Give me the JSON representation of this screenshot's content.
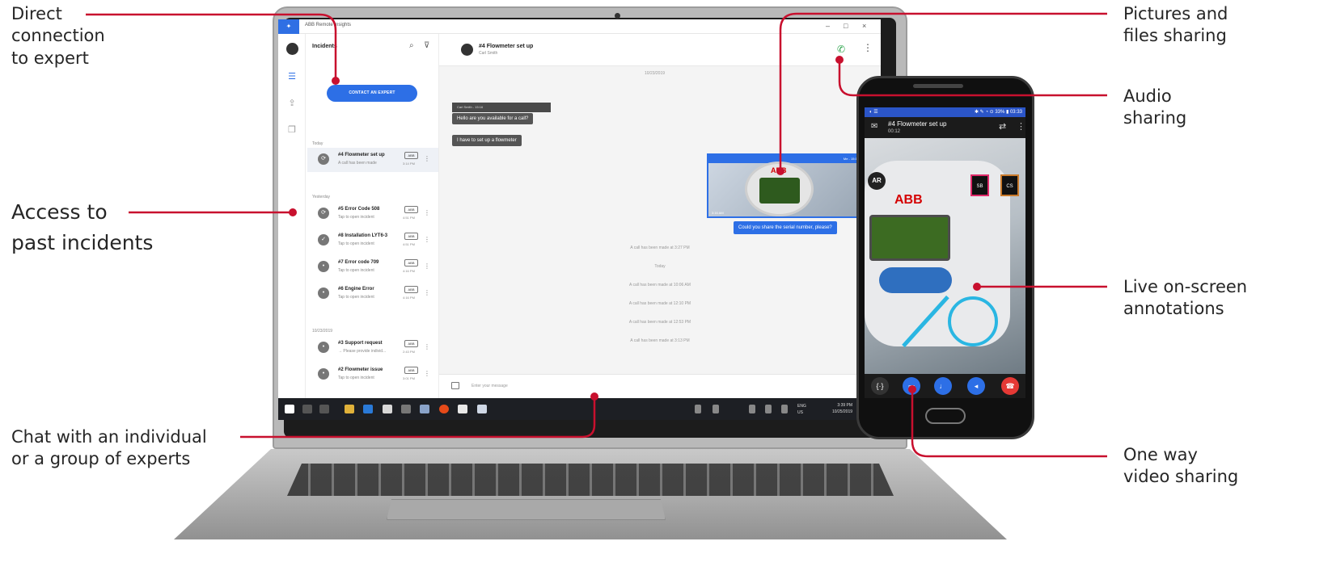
{
  "callouts": {
    "direct_connection": [
      "Direct",
      "connection",
      "to expert"
    ],
    "past_incidents": [
      "Access to",
      "past incidents"
    ],
    "chat_experts": [
      "Chat with an individual",
      "or a group of experts"
    ],
    "pictures_files": [
      "Pictures and",
      "files sharing"
    ],
    "audio": [
      "Audio",
      "sharing"
    ],
    "annotations": [
      "Live on-screen",
      "annotations"
    ],
    "video": [
      "One way",
      "video sharing"
    ]
  },
  "colors": {
    "callout_line": "#c8102e",
    "accent_blue": "#2d6fe6",
    "call_green": "#2aa34a",
    "end_call_red": "#e53935"
  },
  "laptop_app": {
    "window_title": "ABB Remote Insights",
    "window_controls": [
      "–",
      "□",
      "×"
    ],
    "rail_icons": [
      "avatar-icon",
      "incidents-icon",
      "upload-icon",
      "copy-icon"
    ],
    "incidents": {
      "header": "Incidents",
      "search_icon": "search-icon",
      "filter_icon": "filter-icon",
      "contact_button": "CONTACT AN EXPERT",
      "groups": [
        {
          "label": "Today",
          "items": [
            {
              "title": "#4 Flowmeter set up",
              "subtitle": "A call has been made",
              "badge": "ABB",
              "time": "3:14 PM",
              "selected": true
            }
          ]
        },
        {
          "label": "Yesterday",
          "items": [
            {
              "title": "#5 Error Code 508",
              "subtitle": "Tap to open incident",
              "badge": "ABB",
              "time": "4:51 PM",
              "selected": false
            },
            {
              "title": "#8 Installation LYT6-3",
              "subtitle": "Tap to open incident",
              "badge": "ABB",
              "time": "4:51 PM",
              "selected": false
            },
            {
              "title": "#7 Error code 709",
              "subtitle": "Tap to open incident",
              "badge": "ABB",
              "time": "4:16 PM",
              "selected": false
            },
            {
              "title": "#6 Engine Error",
              "subtitle": "Tap to open incident",
              "badge": "ABB",
              "time": "4:16 PM",
              "selected": false
            }
          ]
        },
        {
          "label": "10/23/2019",
          "items": [
            {
              "title": "#3 Support request",
              "subtitle": "→ Please provide individ...",
              "badge": "ABB",
              "time": "2:43 PM",
              "selected": false
            },
            {
              "title": "#2 Flowmeter issue",
              "subtitle": "Tap to open incident",
              "badge": "ABB",
              "time": "3:01 PM",
              "selected": false
            }
          ]
        }
      ]
    },
    "chat": {
      "title": "#4 Flowmeter set up",
      "subtitle": "Carl Smith",
      "date_top": "10/23/2019",
      "bubble_meta": "Carl Smith - 15:16",
      "incoming": [
        "Hello are you available for a call?",
        "I have to set up a flowmeter"
      ],
      "image_meta": "Me - 15:17",
      "image_caption": "ABB",
      "image_time": "3:16 AM",
      "outgoing": "Could you share the serial number, please?",
      "system_messages": [
        "A call has been made at 3:27 PM",
        "Today",
        "A call has been made at 10:06 AM",
        "A call has been made at 12:10 PM",
        "A call has been made at 12:53 PM",
        "A call has been made at 3:13 PM"
      ],
      "composer_placeholder": "Enter your message"
    },
    "taskbar": {
      "clock_time": "3:39 PM",
      "clock_date": "10/25/2019",
      "lang_top": "ENG",
      "lang_bottom": "US"
    }
  },
  "phone_app": {
    "status_left": "◐ ☰",
    "status_right": "✱ ✎ ◔ ⊙ 33% ▮ 03:33",
    "title": "#4 Flowmeter set up",
    "timer": "00:12",
    "video_brand": "ABB",
    "participants": [
      "SB",
      "CS"
    ],
    "ar_badge": "AR",
    "controls": [
      "annotations-toggle-icon",
      "video-camera-icon",
      "microphone-icon",
      "speaker-icon",
      "end-call-icon"
    ]
  }
}
